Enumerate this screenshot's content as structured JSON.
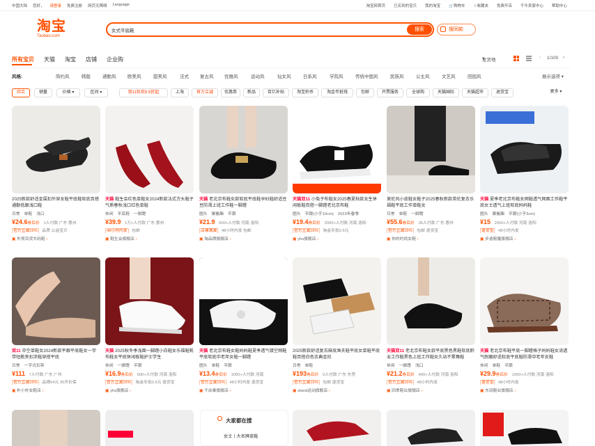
{
  "topbar": {
    "left": [
      "中国大陆",
      "您好，",
      "请登录",
      "免费注册",
      "网页无障碍",
      "Language"
    ],
    "right": [
      "淘宝网首页",
      "已买到的宝贝",
      "我的淘宝",
      "购物车",
      "收藏夹",
      "免费开店",
      "千牛卖家中心",
      "帮助中心"
    ]
  },
  "logo": {
    "cn": "淘宝",
    "en": "Taobao.com"
  },
  "search": {
    "value": "女式平底鞋",
    "button": "搜索",
    "image_search": "搜同款"
  },
  "tabs": [
    "所有宝贝",
    "天猫",
    "淘宝",
    "店铺",
    "企业购"
  ],
  "toolbar": {
    "ship_from": "发货地",
    "page": "1/100",
    "prev": "‹",
    "next": "›"
  },
  "styles": {
    "label": "风格:",
    "items": [
      "简约风",
      "韩版",
      "通勤风",
      "欧美风",
      "甜美风",
      "法式",
      "复古风",
      "优雅风",
      "运动风",
      "仙女风",
      "日系风",
      "学院风",
      "传统中国风",
      "民族风",
      "公主风",
      "文艺风",
      "田园风"
    ],
    "more": "展示选项"
  },
  "filters": {
    "items": [
      "综合",
      "销量",
      "价格",
      "区间",
      "双11狂欢8.5折起",
      "上海",
      "官方立减",
      "优惠券",
      "新品",
      "百亿补贴",
      "淘宝秒杀",
      "淘金币抵钱",
      "包邮",
      "开票服务",
      "全球购",
      "天猫国际",
      "天猫超市",
      "退货宝"
    ],
    "more": "更多"
  },
  "products": [
    {
      "tmall": "",
      "title": "2025新款舒适金属扣外穿女鞋平底鞋软底百搭通勤低跟浅口鞋",
      "tags": [
        "日常",
        "单鞋",
        "浅口"
      ],
      "price": "¥24.6",
      "price_tag": "券后价",
      "sales": "1人付款",
      "loc": "广东 惠州",
      "badges": [
        "官方立减15%",
        "品质",
        "公益宝贝"
      ],
      "shop": "外贸百货大码鞋"
    },
    {
      "tmall": "天猫",
      "title": "鞋生会红色单鞋女2024新款法式方头鞋子气质春秋浅口红色单鞋",
      "tags": [
        "休闲",
        "平底鞋",
        "一脚蹬"
      ],
      "price": "¥39.9",
      "price_tag": "",
      "sales": "1万+人付款",
      "loc": "广东 惠州",
      "badges": [
        "48小时内发",
        "包邮"
      ],
      "shop": "鞋生会旗舰店"
    },
    {
      "tmall": "天猫",
      "title": "老北京布鞋女款软底平底鞋孕妇鞋舒适豆豆防滑上班工作鞋一脚蹬",
      "tags": [
        "圆头",
        "聚氨酯",
        "平跟"
      ],
      "price": "¥21.9",
      "price_tag": "",
      "sales": "600+人付款",
      "loc": "河南 洛阳",
      "badges": [
        "店铺满减",
        "48小时内发",
        "包邮"
      ],
      "shop": "淘品牌旗舰店"
    },
    {
      "tmall": "天猫双11",
      "title": "小兔子布鞋女2025春夏秋款女生休闲板鞋百搭一脚蹬老北京布鞋",
      "tags": [
        "圆头",
        "平跟(小于10cm)",
        "2023年春季"
      ],
      "price": "¥19.4",
      "price_tag": "券后价",
      "sales": "2000+人付款",
      "loc": "河南 洛阳",
      "badges": [
        "官方立减15%",
        "淘金币抵0.6元"
      ],
      "shop": "yhs旗舰店"
    },
    {
      "tmall": "",
      "title": "美伦风小皮鞋女鞋子2025春秋新款英伦复古乐福鞋平底工作单鞋女",
      "tags": [
        "日常",
        "单鞋",
        "一脚蹬"
      ],
      "price": "¥55.6",
      "price_tag": "券后价",
      "sales": "36人付款",
      "loc": "广东 惠州",
      "badges": [
        "官方立减15%",
        "包邮",
        "退货宝"
      ],
      "shop": "你的时尚女鞋"
    },
    {
      "tmall": "天猫",
      "title": "夏季老北京布鞋女网鞋透气网面工作鞋平底女士透气上班软底妈妈鞋",
      "tags": [
        "圆头",
        "聚氨酯",
        "平跟(小于3cm)"
      ],
      "price": "¥15",
      "price_tag": "",
      "sales": "2000+人付款",
      "loc": "河南 洛阳",
      "badges": [
        "退货宝",
        "48小时内发"
      ],
      "shop": "步逍鞋履旗舰店"
    },
    {
      "tmall": "双11",
      "title": "中空单鞋女2024新款平跟平底鞋女一字带短靴夹扣凉鞋穿搭平底",
      "tags": [
        "日常",
        "一字式扣带"
      ],
      "price": "¥111",
      "price_tag": "",
      "sales": "7人付款",
      "loc": "广东 广州",
      "badges": [
        "官方立减15%",
        "品牌64元",
        "30天价保"
      ],
      "shop": "朴小朴女鞋店"
    },
    {
      "tmall": "天猫",
      "title": "2025秋冬季浅面一脚蹬小白鞋女乐福鞋帆布鞋女平底休闲板鞋护士学生",
      "tags": [
        "休闲",
        "一脚蹬",
        "平跟"
      ],
      "price": "¥16.9",
      "price_tag": "券后价",
      "sales": "600+人付款",
      "loc": "河南 洛阳",
      "badges": [
        "官方立减15%",
        "淘金币抵0.5元",
        "退货宝"
      ],
      "shop": "yhs旗舰店"
    },
    {
      "tmall": "天猫",
      "title": "老北京布鞋女鞋妈妈鞋夏季透气镂空网鞋平底软底中老年女鞋一脚蹬",
      "tags": [
        "圆头",
        "单鞋",
        "平跟"
      ],
      "price": "¥13.4",
      "price_tag": "券后价",
      "sales": "1000+人付款",
      "loc": "河南",
      "badges": [
        "官方立减15%",
        "48小时内发",
        "退货宝"
      ],
      "shop": "千幼泰旗舰店"
    },
    {
      "tmall": "",
      "title": "2025新款舒适复古麻底渔夫鞋平底女单鞋平底鞋百搭白色古典金扣",
      "tags": [
        "日常",
        "单鞋"
      ],
      "price": "¥193",
      "price_tag": "券后价",
      "sales": "0人付款",
      "loc": "广东 东莞",
      "badges": [
        "官方立减15%",
        "包邮",
        "退货宝"
      ],
      "shop": "stand运动旗舰店"
    },
    {
      "tmall": "天猫双11",
      "title": "老北京布鞋女款平底黑色黑鞋软底职业工作鞋黑色上班工作鞋女久站不累舞鞋",
      "tags": [
        "休闲",
        "一脚蹬",
        "浅口"
      ],
      "price": "¥21.2",
      "price_tag": "券后价",
      "sales": "400+人付款",
      "loc": "河南 洛阳",
      "badges": [
        "官方立减15%",
        "48小时内发"
      ],
      "shop": "四季鞋业旗舰店"
    },
    {
      "tmall": "天猫",
      "title": "老北京布鞋平底一脚蹬格子妈妈鞋女流透气耐磨舒适软底平底鞋防滑中老年女鞋",
      "tags": [
        "休闲",
        "单鞋",
        "平跟"
      ],
      "price": "¥29.9",
      "price_tag": "券后价",
      "sales": "1000+人付款",
      "loc": "河南 洛阳",
      "badges": [
        "退货宝",
        "48小时内发"
      ],
      "shop": "东润鞋业旗舰店"
    }
  ],
  "image_labels": [
    "显白真的 yyds",
    "天猫双11",
    "夏季女网鞋",
    "NDLY KITSC",
    "天猫双11",
    "品质 保证"
  ],
  "hot": {
    "title": "大家都在搜",
    "query": "女士丨大名牌皮鞋"
  }
}
